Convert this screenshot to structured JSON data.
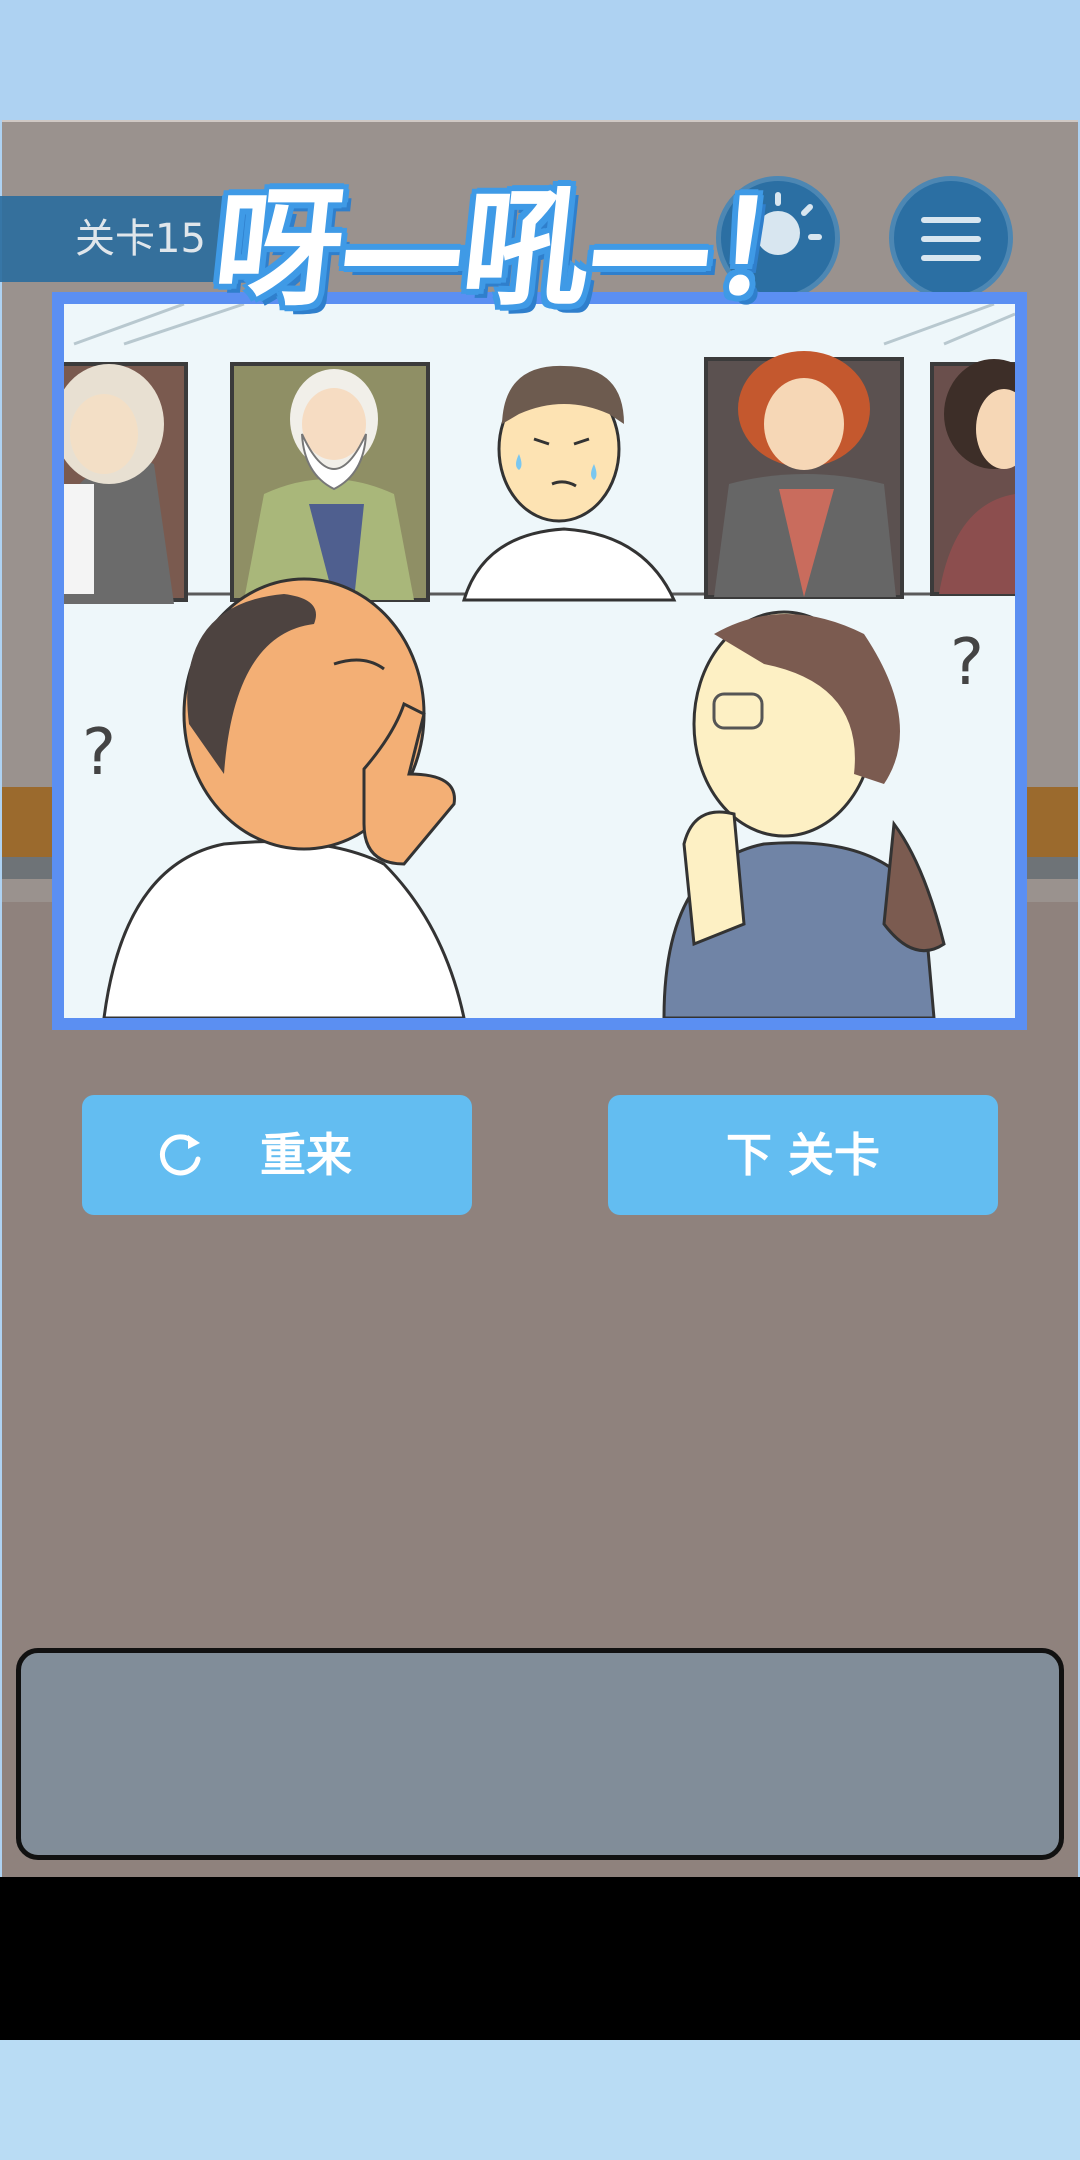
{
  "hud": {
    "level_label": "关卡15"
  },
  "title": {
    "exclamation": "呀—吼—！"
  },
  "buttons": {
    "retry_label": "重来",
    "next_level_label": "下 关卡"
  },
  "colors": {
    "panel_border": "#5b8ff2",
    "button_fill": "#63bdf1",
    "hud_button": "#2b6fa3",
    "floor": "#8f827d",
    "dialog": "#818d99"
  },
  "icons": {
    "hint": "lightbulb-icon",
    "menu": "hamburger-menu-icon",
    "retry": "refresh-icon"
  }
}
